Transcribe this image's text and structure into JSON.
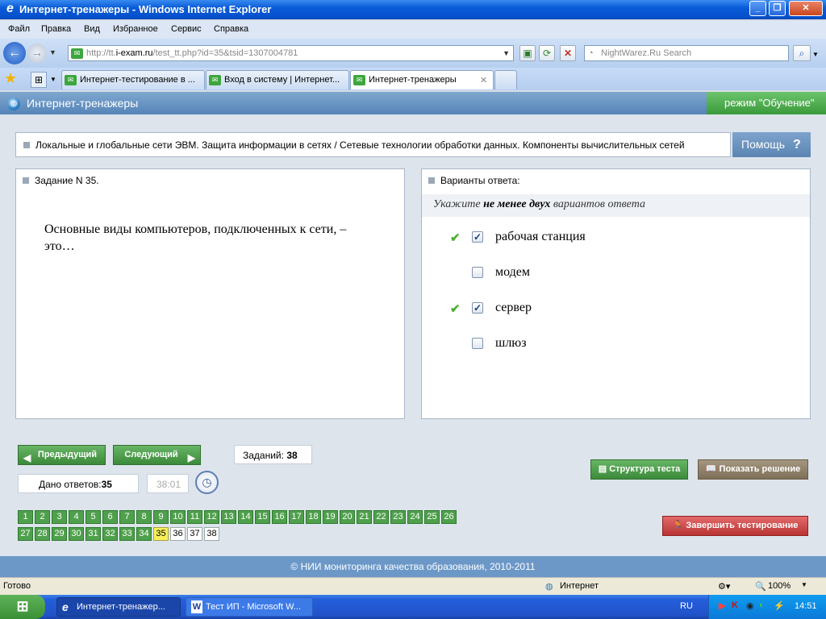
{
  "window": {
    "title": "Интернет-тренажеры - Windows Internet Explorer"
  },
  "menu": [
    "Файл",
    "Правка",
    "Вид",
    "Избранное",
    "Сервис",
    "Справка"
  ],
  "address": {
    "prefix": "http://tt.",
    "host": "i-exam.ru",
    "path": "/test_tt.php?id=35&tsid=1307004781"
  },
  "search": {
    "placeholder": "NightWarez.Ru Search"
  },
  "tabs": [
    {
      "label": "Интернет-тестирование в ..."
    },
    {
      "label": "Вход в систему | Интернет..."
    },
    {
      "label": "Интернет-тренажеры",
      "close": "✕"
    }
  ],
  "app": {
    "name": "Интернет-тренажеры",
    "mode": "режим \"Обучение\""
  },
  "breadcrumb": "Локальные и глобальные сети ЭВМ. Защита информации в сетях / Сетевые технологии обработки данных. Компоненты вычислительных сетей",
  "help": {
    "label": "Помощь",
    "icon": "?"
  },
  "question": {
    "header": "Задание N 35.",
    "text": "Основные виды компьютеров, подключенных к сети, – это…"
  },
  "answers": {
    "header": "Варианты ответа:",
    "hint_prefix": "Укажите ",
    "hint_bold": "не менее двух",
    "hint_suffix": " вариантов ответа",
    "options": [
      {
        "label": "рабочая станция",
        "checked": true,
        "correct": true
      },
      {
        "label": "модем",
        "checked": false,
        "correct": false
      },
      {
        "label": "сервер",
        "checked": true,
        "correct": true
      },
      {
        "label": "шлюз",
        "checked": false,
        "correct": false
      }
    ]
  },
  "nav": {
    "prev": "Предыдущий",
    "next": "Следующий",
    "tasks_label": "Заданий:",
    "tasks_count": "38",
    "answered_label": "Дано ответов:",
    "answered_count": "35",
    "timer": "38:01",
    "structure": "Структура теста",
    "show_solution": "Показать решение",
    "finish": "Завершить тестирование",
    "current": 35,
    "total": 38,
    "answered_upto": 34
  },
  "footer": "© НИИ мониторинга качества образования, 2010-2011",
  "status": {
    "ready": "Готово",
    "zone": "Интернет",
    "zoom": "100%"
  },
  "taskbar": {
    "tasks": [
      "Интернет-тренажер...",
      "Тест ИП - Microsoft W..."
    ],
    "lang": "RU",
    "time": "14:51"
  }
}
